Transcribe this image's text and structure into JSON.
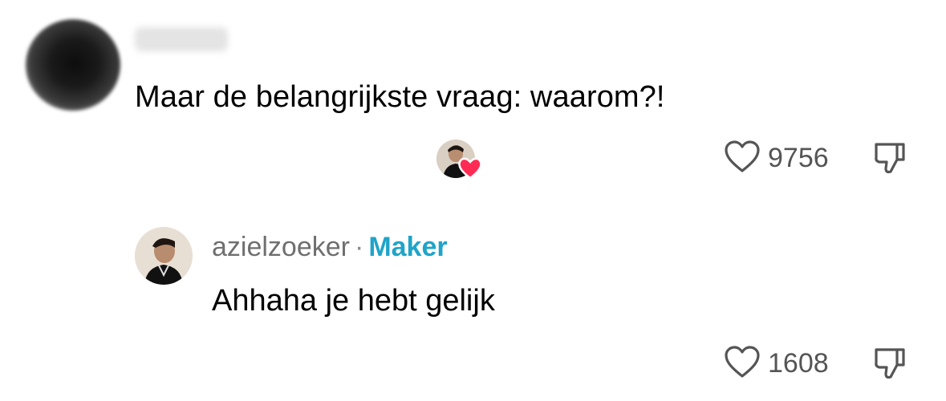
{
  "comment": {
    "author_blurred": true,
    "text": "Maar de belangrijkste vraag: waarom?!",
    "liked_by_creator": true,
    "likes": "9756"
  },
  "reply": {
    "username": "azielzoeker",
    "separator": "·",
    "badge": "Maker",
    "text": "Ahhaha je hebt gelijk",
    "likes": "1608"
  },
  "icons": {
    "like": "heart-outline-icon",
    "dislike": "thumbs-down-outline-icon",
    "creator_heart": "heart-filled-icon"
  },
  "colors": {
    "maker_badge": "#20a4c9",
    "creator_heart": "#fe2c55",
    "secondary_text": "#6f6f6f"
  }
}
